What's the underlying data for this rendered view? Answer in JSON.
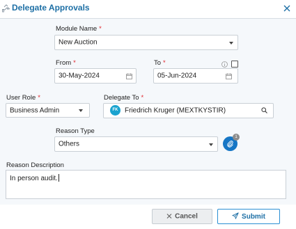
{
  "dialog": {
    "title": "Delegate Approvals",
    "title_icon": "delegate-hand-icon",
    "close_icon": "close-icon"
  },
  "form": {
    "module_name": {
      "label": "Module Name",
      "required_mark": "*",
      "value": "New Auction"
    },
    "from": {
      "label": "From",
      "required_mark": "*",
      "value": "30-May-2024"
    },
    "to": {
      "label": "To",
      "required_mark": "*",
      "value": "05-Jun-2024"
    },
    "user_role": {
      "label": "User Role",
      "required_mark": "*",
      "value": "Business Admin"
    },
    "delegate_to": {
      "label": "Delegate To",
      "required_mark": "*",
      "initials": "FK",
      "value": "Friedrich Kruger (MEXTKYSTIR)"
    },
    "reason_type": {
      "label": "Reason Type",
      "value": "Others"
    },
    "attachment": {
      "count": "1",
      "icon": "paperclip-icon"
    },
    "reason_description": {
      "label": "Reason Description",
      "value": "In person audit."
    }
  },
  "buttons": {
    "cancel": "Cancel",
    "submit": "Submit"
  },
  "colors": {
    "accent": "#1d6fa5",
    "required": "#e0282e",
    "attach_button": "#1676c5",
    "avatar": "#1aa3cf"
  }
}
